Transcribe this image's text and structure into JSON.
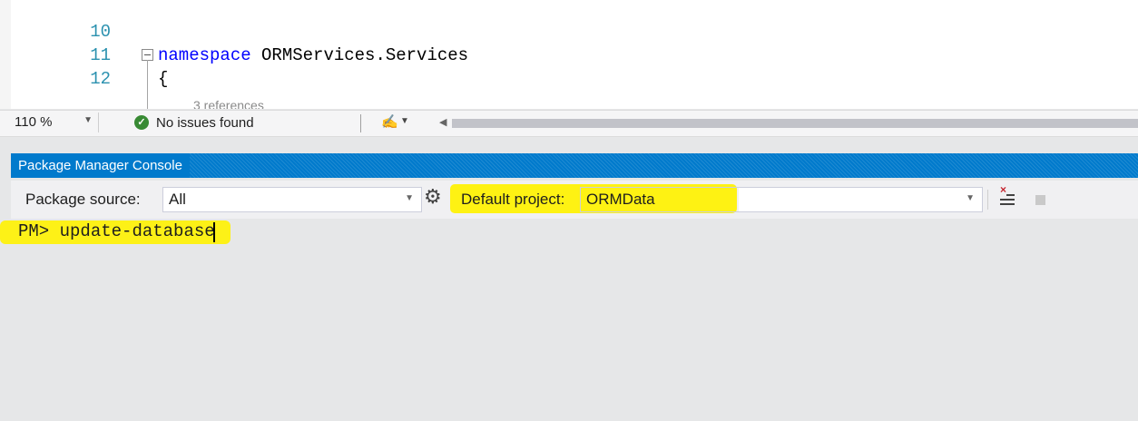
{
  "editor": {
    "lines": [
      {
        "number": "10",
        "keyword": "",
        "text": ""
      },
      {
        "number": "11",
        "keyword": "namespace",
        "text": " ORMServices.Services"
      },
      {
        "number": "12",
        "keyword": "",
        "text": "{"
      }
    ],
    "codelens": "3 references"
  },
  "statusbar": {
    "zoom": "110 %",
    "issues": "No issues found"
  },
  "console": {
    "title": "Package Manager Console",
    "package_source_label": "Package source:",
    "package_source_value": "All",
    "default_project_label": "Default project:",
    "default_project_value": "ORMData",
    "prompt": "PM>",
    "command": "update-database"
  },
  "colors": {
    "accent": "#007acc",
    "highlight": "#fff200",
    "keyword": "#0000ff",
    "line_number": "#2b91af",
    "success": "#388a34"
  },
  "icons": [
    "fold-minus-icon",
    "check-circle-icon",
    "brush-icon",
    "chevron-down-icon",
    "scroll-left-icon",
    "gear-icon",
    "clear-console-icon",
    "stop-icon"
  ]
}
